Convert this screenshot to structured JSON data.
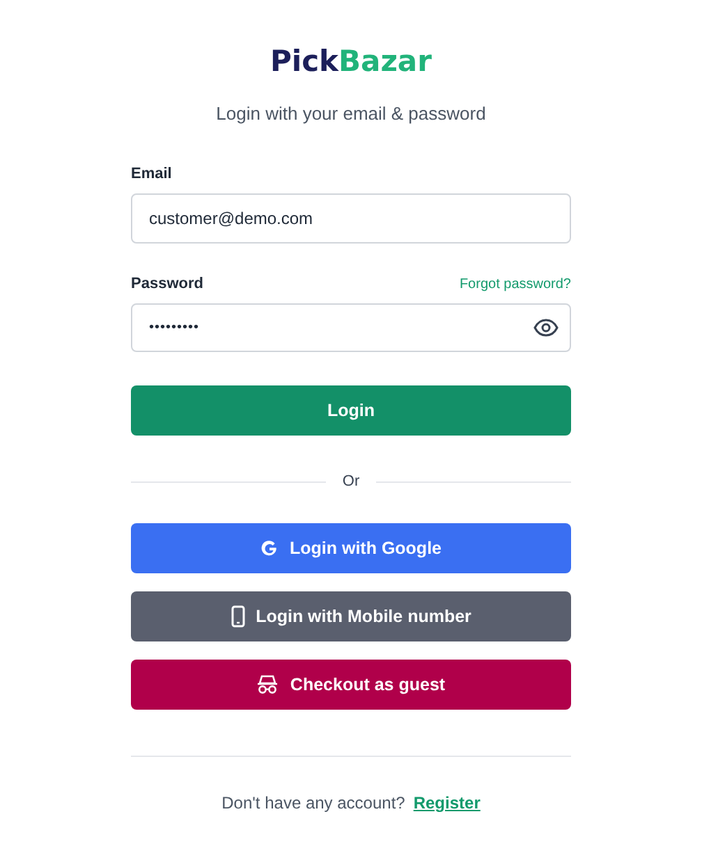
{
  "logo": {
    "first": "Pick",
    "second": "Bazar"
  },
  "subtitle": "Login with your email & password",
  "email": {
    "label": "Email",
    "value": "customer@demo.com"
  },
  "password": {
    "label": "Password",
    "value": "•••••••••",
    "forgot": "Forgot password?"
  },
  "login_button": "Login",
  "divider": "Or",
  "social_buttons": [
    {
      "kind": "google",
      "label": "Login with Google",
      "color": "#3a6ff2"
    },
    {
      "kind": "mobile",
      "label": "Login with Mobile number",
      "color": "#5a5f6e"
    },
    {
      "kind": "guest",
      "label": "Checkout as guest",
      "color": "#b0004a"
    }
  ],
  "footer": {
    "text": "Don't have any account?",
    "link": "Register"
  }
}
